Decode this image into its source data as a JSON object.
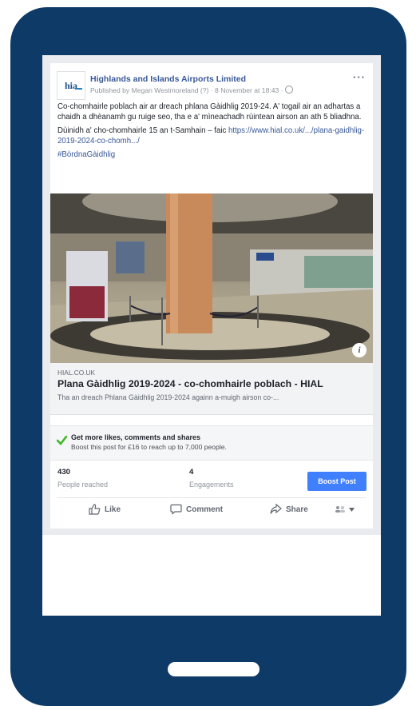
{
  "post": {
    "page_name": "Highlands and Islands Airports Limited",
    "published_line": "Published by Megan Westmoreland (?) · 8 November at 18:43 ·",
    "avatar_text": "hia",
    "more_label": "···",
    "text_para1": "Co-chomhairle poblach air ar dreach phlana Gàidhlig 2019-24. A' togail air an adhartas a chaidh a dhèanamh gu ruige seo, tha e a' mìneachadh rùintean airson an ath 5 bliadhna.",
    "text_para2_prefix": "Dùinidh a' cho-chomhairle 15 an t-Samhain – faic ",
    "text_para2_link": "https://www.hial.co.uk/.../plana-gaidhlig-2019-2024-co-chomh.../",
    "hashtag": "#BòrdnaGàidhlig"
  },
  "link_preview": {
    "domain": "HIAL.CO.UK",
    "title": "Plana Gàidhlig 2019-2024 - co-chomhairle poblach - HIAL",
    "description": "Tha an dreach Phlana Gàidhlig 2019-2024 againn a-muigh airson co-...",
    "info_label": "i"
  },
  "promo": {
    "title": "Get more likes, comments and shares",
    "subtitle": "Boost this post for £16 to reach up to 7,000 people."
  },
  "stats": {
    "reached_value": "430",
    "reached_label": "People reached",
    "engagements_value": "4",
    "engagements_label": "Engagements",
    "boost_button": "Boost Post"
  },
  "actions": {
    "like": "Like",
    "comment": "Comment",
    "share": "Share"
  },
  "colors": {
    "phone_frame": "#0e3a67",
    "link_blue": "#385898",
    "boost_blue": "#4080ff",
    "check_green": "#42b72a"
  }
}
